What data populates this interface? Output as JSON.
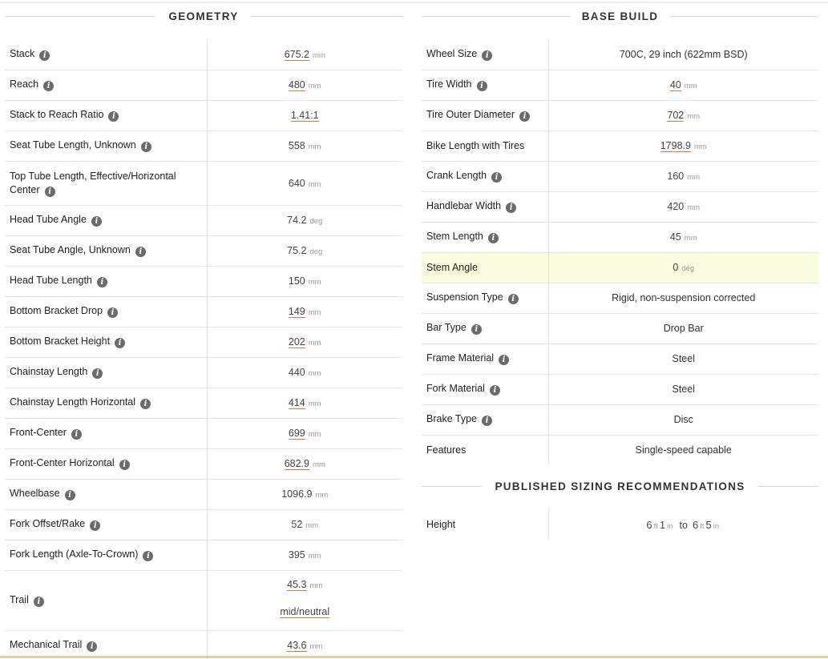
{
  "geometry": {
    "title": "GEOMETRY",
    "rows": [
      {
        "label": "Stack",
        "info": true,
        "value": "675.2",
        "unit": "mm",
        "underline": true
      },
      {
        "label": "Reach",
        "info": true,
        "value": "480",
        "unit": "mm",
        "underline": true
      },
      {
        "label": "Stack to Reach Ratio",
        "info": true,
        "value": "1.41:1",
        "unit": "",
        "underline": true
      },
      {
        "label": "Seat Tube Length, Unknown",
        "info": true,
        "value": "558",
        "unit": "mm",
        "underline": false
      },
      {
        "label": "Top Tube Length, Effective/Horizontal Center",
        "info": true,
        "value": "640",
        "unit": "mm",
        "underline": false,
        "tall": true
      },
      {
        "label": "Head Tube Angle",
        "info": true,
        "value": "74.2",
        "unit": "deg",
        "underline": false
      },
      {
        "label": "Seat Tube Angle, Unknown",
        "info": true,
        "value": "75.2",
        "unit": "deg",
        "underline": false
      },
      {
        "label": "Head Tube Length",
        "info": true,
        "value": "150",
        "unit": "mm",
        "underline": false
      },
      {
        "label": "Bottom Bracket Drop",
        "info": true,
        "value": "149",
        "unit": "mm",
        "underline": true
      },
      {
        "label": "Bottom Bracket Height",
        "info": true,
        "value": "202",
        "unit": "mm",
        "underline": true
      },
      {
        "label": "Chainstay Length",
        "info": true,
        "value": "440",
        "unit": "mm",
        "underline": false
      },
      {
        "label": "Chainstay Length Horizontal",
        "info": true,
        "value": "414",
        "unit": "mm",
        "underline": true
      },
      {
        "label": "Front-Center",
        "info": true,
        "value": "699",
        "unit": "mm",
        "underline": true
      },
      {
        "label": "Front-Center Horizontal",
        "info": true,
        "value": "682.9",
        "unit": "mm",
        "underline": true
      },
      {
        "label": "Wheelbase",
        "info": true,
        "value": "1096.9",
        "unit": "mm",
        "underline": false
      },
      {
        "label": "Fork Offset/Rake",
        "info": true,
        "value": "52",
        "unit": "mm",
        "underline": false
      },
      {
        "label": "Fork Length (Axle-To-Crown)",
        "info": true,
        "value": "395",
        "unit": "mm",
        "underline": false
      },
      {
        "label": "Trail",
        "info": true,
        "value": "45.3",
        "unit": "mm",
        "underline": true,
        "extra": "mid/neutral"
      },
      {
        "label": "Mechanical Trail",
        "info": true,
        "value": "43.6",
        "unit": "mm",
        "underline": true
      }
    ]
  },
  "base_build": {
    "title": "BASE BUILD",
    "rows": [
      {
        "label": "Wheel Size",
        "info": true,
        "value": "700C, 29 inch (622mm BSD)",
        "unit": "",
        "underline": false,
        "text": true
      },
      {
        "label": "Tire Width",
        "info": true,
        "value": "40",
        "unit": "mm",
        "underline": true
      },
      {
        "label": "Tire Outer Diameter",
        "info": true,
        "value": "702",
        "unit": "mm",
        "underline": true
      },
      {
        "label": "Bike Length with Tires",
        "info": false,
        "value": "1798.9",
        "unit": "mm",
        "underline": true
      },
      {
        "label": "Crank Length",
        "info": true,
        "value": "160",
        "unit": "mm",
        "underline": false
      },
      {
        "label": "Handlebar Width",
        "info": true,
        "value": "420",
        "unit": "mm",
        "underline": false
      },
      {
        "label": "Stem Length",
        "info": true,
        "value": "45",
        "unit": "mm",
        "underline": false
      },
      {
        "label": "Stem Angle",
        "info": false,
        "value": "0",
        "unit": "deg",
        "underline": false,
        "highlight": true
      },
      {
        "label": "Suspension Type",
        "info": true,
        "value": "Rigid, non-suspension corrected",
        "unit": "",
        "underline": false,
        "text": true
      },
      {
        "label": "Bar Type",
        "info": true,
        "value": "Drop Bar",
        "unit": "",
        "underline": false,
        "text": true
      },
      {
        "label": "Frame Material",
        "info": true,
        "value": "Steel",
        "unit": "",
        "underline": false,
        "text": true
      },
      {
        "label": "Fork Material",
        "info": true,
        "value": "Steel",
        "unit": "",
        "underline": false,
        "text": true
      },
      {
        "label": "Brake Type",
        "info": true,
        "value": "Disc",
        "unit": "",
        "underline": false,
        "text": true
      },
      {
        "label": "Features",
        "info": false,
        "value": "Single-speed capable",
        "unit": "",
        "underline": false,
        "text": true
      }
    ]
  },
  "sizing": {
    "title": "PUBLISHED SIZING RECOMMENDATIONS",
    "label": "Height",
    "from_ft": "6",
    "from_in": "1",
    "to_ft": "6",
    "to_in": "5",
    "ft_unit": "ft",
    "in_unit": "in",
    "to_word": "to"
  },
  "icons": {
    "info": "info-icon"
  },
  "colors": {
    "underline": "#e07a42",
    "highlight": "#fbfbe0",
    "bottom_rule": "#e2cf96"
  }
}
